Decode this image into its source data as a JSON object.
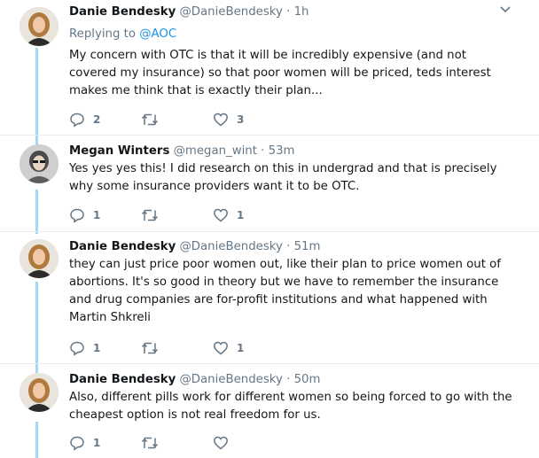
{
  "colors": {
    "accent": "#1b95e0",
    "thread_line": "#a4d9f5",
    "muted": "#657786",
    "divider": "#e6ecf0"
  },
  "tweets": [
    {
      "name": "Danie Bendesky",
      "handle": "@DanieBendesky",
      "dot": "·",
      "time": "1h",
      "replying_label": "Replying to",
      "replying_to": "@AOC",
      "text": "My concern with OTC is that it will be incredibly expensive (and not covered my insurance) so that poor women will be priced, teds interest makes me think that is exactly their plan...",
      "replies": "2",
      "retweets": "",
      "likes": "3",
      "icons": {
        "reply": "reply-icon",
        "retweet": "retweet-icon",
        "like": "heart-icon",
        "menu": "chevron-down-icon"
      }
    },
    {
      "name": "Megan Winters",
      "handle": "@megan_wint",
      "dot": "·",
      "time": "53m",
      "text": "Yes yes yes this! I did research on this in undergrad and that is precisely why some insurance providers want it to be OTC.",
      "replies": "1",
      "retweets": "",
      "likes": "1"
    },
    {
      "name": "Danie Bendesky",
      "handle": "@DanieBendesky",
      "dot": "·",
      "time": "51m",
      "text": "they can just price poor women out, like their plan to price women out of abortions. It's so good in theory but we have to remember the insurance and drug companies are for-profit institutions and what happened with Martin Shkreli",
      "replies": "1",
      "retweets": "",
      "likes": "1"
    },
    {
      "name": "Danie Bendesky",
      "handle": "@DanieBendesky",
      "dot": "·",
      "time": "50m",
      "text": "Also, different pills work for different women so being forced to go with the cheapest option is not real freedom for us.",
      "replies": "1",
      "retweets": "",
      "likes": ""
    }
  ]
}
